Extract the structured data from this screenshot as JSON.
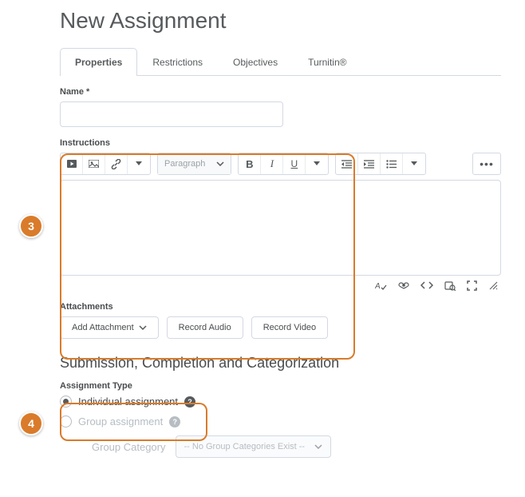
{
  "title": "New Assignment",
  "tabs": [
    "Properties",
    "Restrictions",
    "Objectives",
    "Turnitin®"
  ],
  "name": {
    "label": "Name *",
    "value": ""
  },
  "instructions": {
    "label": "Instructions",
    "paragraph": "Paragraph"
  },
  "attachments": {
    "label": "Attachments",
    "buttons": {
      "add": "Add Attachment",
      "audio": "Record Audio",
      "video": "Record Video"
    }
  },
  "section_title": "Submission, Completion and Categorization",
  "assignment_type": {
    "label": "Assignment Type",
    "individual": "Individual assignment",
    "group": "Group assignment",
    "group_category_label": "Group Category",
    "group_category_placeholder": "-- No Group Categories Exist --"
  },
  "annotations": {
    "step3": "3",
    "step4": "4"
  }
}
